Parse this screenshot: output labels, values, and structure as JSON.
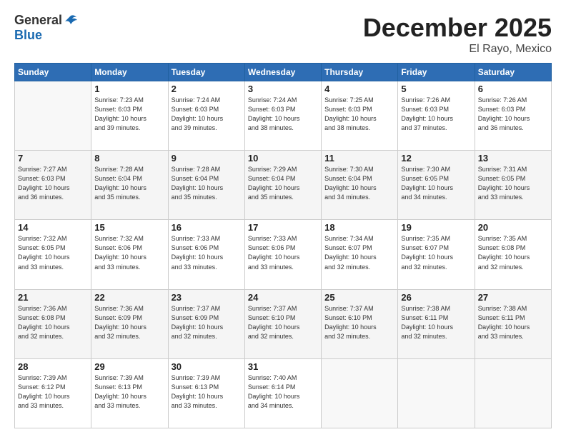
{
  "logo": {
    "line1": "General",
    "line2": "Blue"
  },
  "title": "December 2025",
  "subtitle": "El Rayo, Mexico",
  "days_header": [
    "Sunday",
    "Monday",
    "Tuesday",
    "Wednesday",
    "Thursday",
    "Friday",
    "Saturday"
  ],
  "weeks": [
    [
      {
        "day": "",
        "info": ""
      },
      {
        "day": "1",
        "info": "Sunrise: 7:23 AM\nSunset: 6:03 PM\nDaylight: 10 hours\nand 39 minutes."
      },
      {
        "day": "2",
        "info": "Sunrise: 7:24 AM\nSunset: 6:03 PM\nDaylight: 10 hours\nand 39 minutes."
      },
      {
        "day": "3",
        "info": "Sunrise: 7:24 AM\nSunset: 6:03 PM\nDaylight: 10 hours\nand 38 minutes."
      },
      {
        "day": "4",
        "info": "Sunrise: 7:25 AM\nSunset: 6:03 PM\nDaylight: 10 hours\nand 38 minutes."
      },
      {
        "day": "5",
        "info": "Sunrise: 7:26 AM\nSunset: 6:03 PM\nDaylight: 10 hours\nand 37 minutes."
      },
      {
        "day": "6",
        "info": "Sunrise: 7:26 AM\nSunset: 6:03 PM\nDaylight: 10 hours\nand 36 minutes."
      }
    ],
    [
      {
        "day": "7",
        "info": "Sunrise: 7:27 AM\nSunset: 6:03 PM\nDaylight: 10 hours\nand 36 minutes."
      },
      {
        "day": "8",
        "info": "Sunrise: 7:28 AM\nSunset: 6:04 PM\nDaylight: 10 hours\nand 35 minutes."
      },
      {
        "day": "9",
        "info": "Sunrise: 7:28 AM\nSunset: 6:04 PM\nDaylight: 10 hours\nand 35 minutes."
      },
      {
        "day": "10",
        "info": "Sunrise: 7:29 AM\nSunset: 6:04 PM\nDaylight: 10 hours\nand 35 minutes."
      },
      {
        "day": "11",
        "info": "Sunrise: 7:30 AM\nSunset: 6:04 PM\nDaylight: 10 hours\nand 34 minutes."
      },
      {
        "day": "12",
        "info": "Sunrise: 7:30 AM\nSunset: 6:05 PM\nDaylight: 10 hours\nand 34 minutes."
      },
      {
        "day": "13",
        "info": "Sunrise: 7:31 AM\nSunset: 6:05 PM\nDaylight: 10 hours\nand 33 minutes."
      }
    ],
    [
      {
        "day": "14",
        "info": "Sunrise: 7:32 AM\nSunset: 6:05 PM\nDaylight: 10 hours\nand 33 minutes."
      },
      {
        "day": "15",
        "info": "Sunrise: 7:32 AM\nSunset: 6:06 PM\nDaylight: 10 hours\nand 33 minutes."
      },
      {
        "day": "16",
        "info": "Sunrise: 7:33 AM\nSunset: 6:06 PM\nDaylight: 10 hours\nand 33 minutes."
      },
      {
        "day": "17",
        "info": "Sunrise: 7:33 AM\nSunset: 6:06 PM\nDaylight: 10 hours\nand 33 minutes."
      },
      {
        "day": "18",
        "info": "Sunrise: 7:34 AM\nSunset: 6:07 PM\nDaylight: 10 hours\nand 32 minutes."
      },
      {
        "day": "19",
        "info": "Sunrise: 7:35 AM\nSunset: 6:07 PM\nDaylight: 10 hours\nand 32 minutes."
      },
      {
        "day": "20",
        "info": "Sunrise: 7:35 AM\nSunset: 6:08 PM\nDaylight: 10 hours\nand 32 minutes."
      }
    ],
    [
      {
        "day": "21",
        "info": "Sunrise: 7:36 AM\nSunset: 6:08 PM\nDaylight: 10 hours\nand 32 minutes."
      },
      {
        "day": "22",
        "info": "Sunrise: 7:36 AM\nSunset: 6:09 PM\nDaylight: 10 hours\nand 32 minutes."
      },
      {
        "day": "23",
        "info": "Sunrise: 7:37 AM\nSunset: 6:09 PM\nDaylight: 10 hours\nand 32 minutes."
      },
      {
        "day": "24",
        "info": "Sunrise: 7:37 AM\nSunset: 6:10 PM\nDaylight: 10 hours\nand 32 minutes."
      },
      {
        "day": "25",
        "info": "Sunrise: 7:37 AM\nSunset: 6:10 PM\nDaylight: 10 hours\nand 32 minutes."
      },
      {
        "day": "26",
        "info": "Sunrise: 7:38 AM\nSunset: 6:11 PM\nDaylight: 10 hours\nand 32 minutes."
      },
      {
        "day": "27",
        "info": "Sunrise: 7:38 AM\nSunset: 6:11 PM\nDaylight: 10 hours\nand 33 minutes."
      }
    ],
    [
      {
        "day": "28",
        "info": "Sunrise: 7:39 AM\nSunset: 6:12 PM\nDaylight: 10 hours\nand 33 minutes."
      },
      {
        "day": "29",
        "info": "Sunrise: 7:39 AM\nSunset: 6:13 PM\nDaylight: 10 hours\nand 33 minutes."
      },
      {
        "day": "30",
        "info": "Sunrise: 7:39 AM\nSunset: 6:13 PM\nDaylight: 10 hours\nand 33 minutes."
      },
      {
        "day": "31",
        "info": "Sunrise: 7:40 AM\nSunset: 6:14 PM\nDaylight: 10 hours\nand 34 minutes."
      },
      {
        "day": "",
        "info": ""
      },
      {
        "day": "",
        "info": ""
      },
      {
        "day": "",
        "info": ""
      }
    ]
  ]
}
